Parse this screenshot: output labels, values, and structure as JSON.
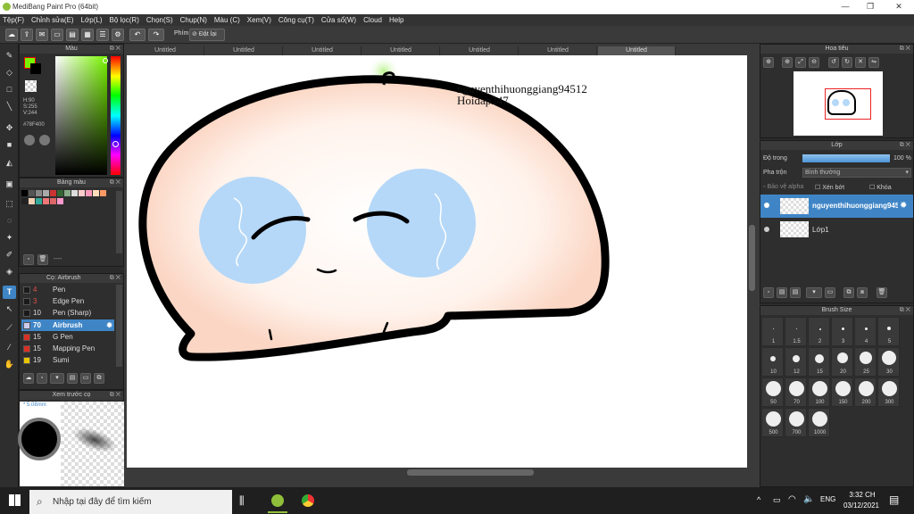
{
  "window": {
    "title": "MediBang Paint Pro (64bit)"
  },
  "menu": [
    "Tệp(F)",
    "Chỉnh sửa(E)",
    "Lớp(L)",
    "Bộ lọc(R)",
    "Chọn(S)",
    "Chụp(N)",
    "Màu (C)",
    "Xem(V)",
    "Công cụ(T)",
    "Cửa sổ(W)",
    "Cloud",
    "Help"
  ],
  "toolbar": {
    "key_label": "Phím",
    "reset_label": "Đặt lại"
  },
  "color_panel": {
    "title": "Màu",
    "h": "H:90",
    "s": "S:255",
    "v": "V:244",
    "hex": "#78F400",
    "fg": "#78f400"
  },
  "palette_panel": {
    "title": "Bảng màu",
    "footer": "----"
  },
  "brush_panel": {
    "title": "Cọ: Airbrush",
    "items": [
      {
        "size": "4",
        "name": "Pen",
        "color": "#1a1a1a"
      },
      {
        "size": "3",
        "name": "Edge Pen",
        "color": "#1a1a1a"
      },
      {
        "size": "10",
        "name": "Pen (Sharp)",
        "color": "#1a1a1a"
      },
      {
        "size": "70",
        "name": "Airbrush",
        "color": "#1a1a1a"
      },
      {
        "size": "15",
        "name": "G Pen",
        "color": "#d93025"
      },
      {
        "size": "15",
        "name": "Mapping Pen",
        "color": "#d93025"
      },
      {
        "size": "19",
        "name": "Sumi",
        "color": "#e8c400"
      }
    ]
  },
  "preview_panel": {
    "title": "Xem trước cọ",
    "size": "5.08mm"
  },
  "tabs": [
    "Untitled",
    "Untitled",
    "Untitled",
    "Untitled",
    "Untitled",
    "Untitled",
    "Untitled"
  ],
  "canvas_text": {
    "line1": "nguyenthihuonggiang94512",
    "line2": "Hoidap247"
  },
  "nav_panel": {
    "title": "Hoa tiêu"
  },
  "layer_panel": {
    "title": "Lớp",
    "opacity_label": "Độ trong",
    "opacity_value": "100 %",
    "blend_label": "Pha trộn",
    "blend_value": "Bình thường",
    "protect_alpha": "Bảo vệ alpha",
    "clip": "Xén bớt",
    "lock": "Khóa",
    "layers": [
      {
        "name": "nguyenthihuonggiang94512"
      },
      {
        "name": "Lớp1"
      }
    ]
  },
  "brushsize_panel": {
    "title": "Brush Size",
    "sizes": [
      "1",
      "1.5",
      "2",
      "3",
      "4",
      "5",
      "10",
      "12",
      "15",
      "20",
      "25",
      "30",
      "50",
      "70",
      "100",
      "150",
      "200",
      "300",
      "500",
      "700",
      "1000"
    ]
  },
  "taskbar": {
    "search_placeholder": "Nhập tại đây để tìm kiếm",
    "time": "3:32 CH",
    "date": "03/12/2021",
    "lang": "ENG"
  }
}
